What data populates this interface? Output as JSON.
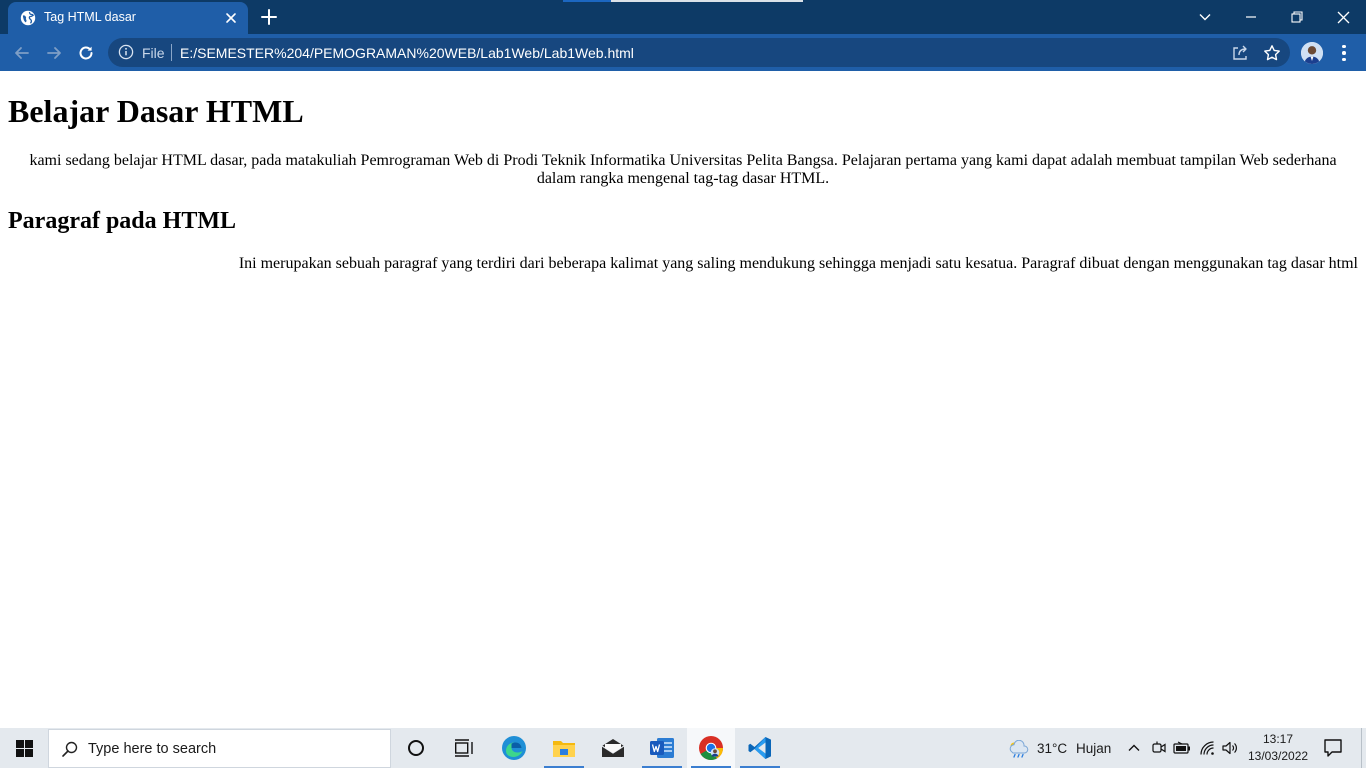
{
  "browser": {
    "tab": {
      "title": "Tag HTML dasar",
      "favicon": "globe-icon"
    },
    "address_bar": {
      "scheme_label": "File",
      "url": "E:/SEMESTER%204/PEMOGRAMAN%20WEB/Lab1Web/Lab1Web.html"
    },
    "colors": {
      "titlebar": "#0d3a66",
      "toolbar": "#1f5ea8",
      "omnibox": "#17477f"
    }
  },
  "page": {
    "heading": "Belajar Dasar HTML",
    "intro": "kami sedang belajar HTML dasar, pada matakuliah Pemrograman Web di Prodi Teknik Informatika Universitas Pelita Bangsa. Pelajaran pertama yang kami dapat adalah membuat tampilan Web sederhana dalam rangka mengenal tag-tag dasar HTML.",
    "subheading": "Paragraf pada HTML",
    "paragraph": "Ini merupakan sebuah paragraf yang terdiri dari beberapa kalimat yang saling mendukung sehingga menjadi satu kesatua. Paragraf dibuat dengan menggunakan tag dasar html"
  },
  "taskbar": {
    "search_placeholder": "Type here to search",
    "apps": [
      "cortana-icon",
      "task-view-icon",
      "edge-icon",
      "file-explorer-icon",
      "mail-icon",
      "word-icon",
      "chrome-icon",
      "vscode-icon"
    ],
    "weather": {
      "temperature": "31°C",
      "condition": "Hujan",
      "icon": "rain-cloud-icon"
    },
    "clock": {
      "time": "13:17",
      "date": "13/03/2022"
    }
  }
}
